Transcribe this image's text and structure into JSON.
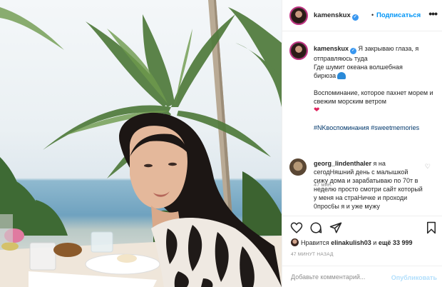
{
  "post": {
    "author": "kamenskux",
    "follow_label": "Подписаться",
    "dot": "•",
    "more": "•••"
  },
  "caption": {
    "author": "kamenskux",
    "line1": "Я закрываю глаза, я отправляюсь туда",
    "line2": "Где шумит океана волшебная",
    "line3": "бирюза",
    "para2": "Воспоминание, которое пахнет морем и свежим морским ветром",
    "hashtags": "#NKвоспоминания #sweetmemories",
    "time": "47 мин."
  },
  "comment": {
    "author": "georg_lindenthaler",
    "text": "я на сегодНяшний день с малышкой сижу дома и зарабатываю по 70т в неделю просто смотри сайт который у меня на страНичке и проходи 0прос6ы я и уже мужу"
  },
  "likes": {
    "prefix": "Нравится",
    "user": "elinakulish03",
    "middle": "и",
    "count": "ещё 33 999"
  },
  "timestamp": "47 МИНУТ НАЗАД",
  "add_comment": {
    "placeholder": "Добавьте комментарий...",
    "post_label": "Опубликовать"
  },
  "icons": [
    "heart-icon",
    "comment-icon",
    "share-icon",
    "bookmark-icon",
    "verified-badge-icon",
    "more-options-icon"
  ],
  "colors": {
    "accent": "#0095f6",
    "verified": "#3897f0",
    "hashtag": "#00376b",
    "muted": "#8e8e8e"
  }
}
